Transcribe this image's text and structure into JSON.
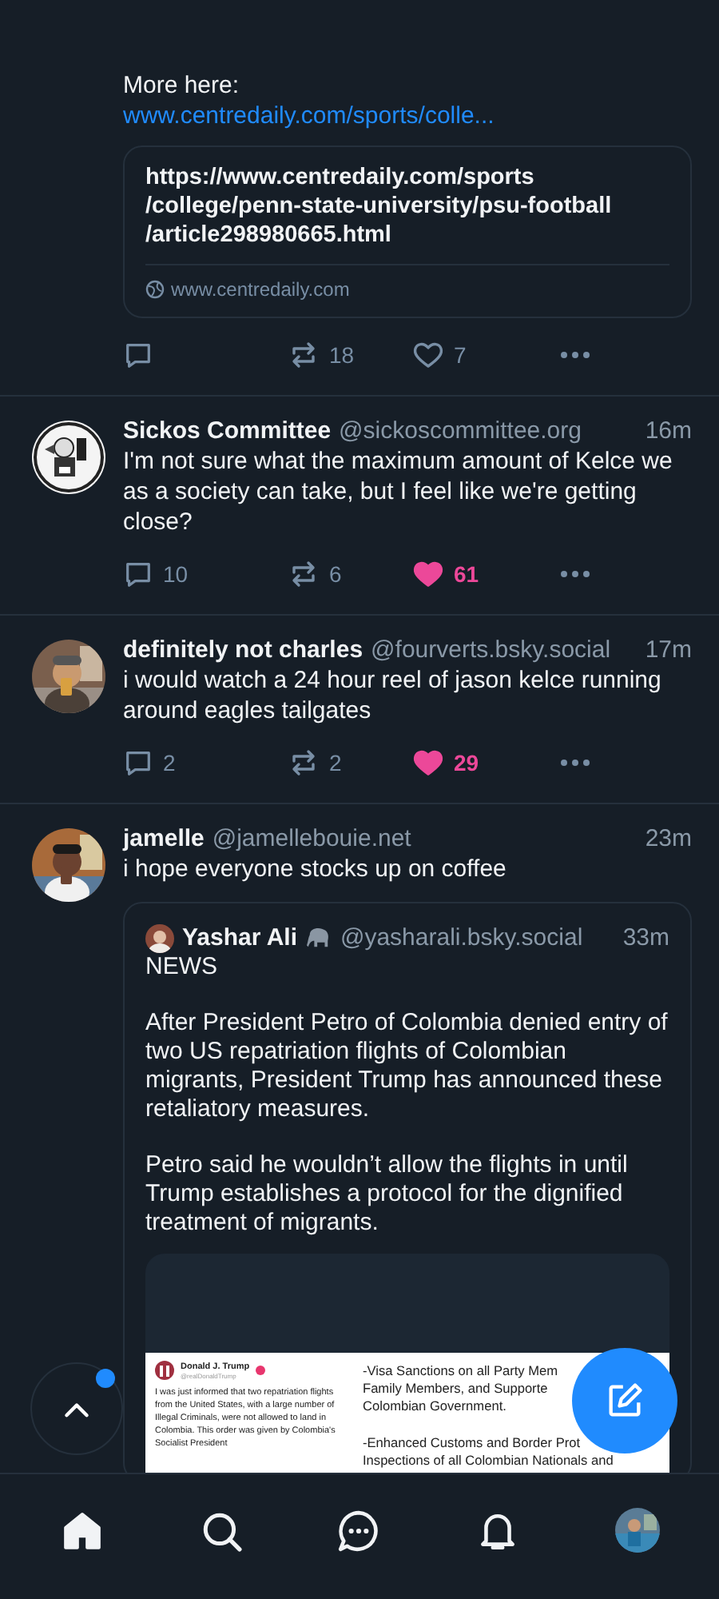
{
  "posts": [
    {
      "kind": "continuation",
      "paragraphs": [
        "More here:"
      ],
      "link": "www.centredaily.com/sports/colle...",
      "link_card": {
        "title_lines": [
          "https://www.centredaily.com/sports",
          "/college/penn-state-university/psu-football",
          "/article298980665.html"
        ],
        "domain": "www.centredaily.com"
      },
      "actions": {
        "reposts": "18",
        "likes": "7",
        "liked": false
      }
    },
    {
      "kind": "post",
      "name": "Sickos Committee",
      "handle": "@sickoscommittee.org",
      "time": "16m",
      "paragraphs": [
        "I'm not sure what the maximum amount of Kelce we as a society can take, but I feel like we're getting close?"
      ],
      "actions": {
        "replies": "10",
        "reposts": "6",
        "likes": "61",
        "liked": true
      }
    },
    {
      "kind": "post",
      "name": "definitely not charles",
      "handle": "@fourverts.bsky.social",
      "time": "17m",
      "paragraphs": [
        "i would watch a 24 hour reel of jason kelce running around eagles tailgates"
      ],
      "actions": {
        "replies": "2",
        "reposts": "2",
        "likes": "29",
        "liked": true
      }
    },
    {
      "kind": "post",
      "name": "jamelle",
      "handle": "@jamellebouie.net",
      "time": "23m",
      "paragraphs": [
        "i hope everyone stocks up on coffee"
      ],
      "quote": {
        "name": "Yashar Ali",
        "handle": "@yasharali.bsky.social",
        "time": "33m",
        "paragraphs": [
          "NEWS",
          "After President Petro of Colombia denied entry of two US repatriation flights of Colombian migrants, President Trump has announced these retaliatory measures.",
          "Petro said he wouldn’t allow the flights in until Trump establishes a protocol for the dignified treatment of migrants."
        ],
        "image": {
          "author": "Donald J. Trump",
          "handle": "@realDonaldTrump",
          "body": "I was just informed that two repatriation flights from the United States, with a large number of Illegal Criminals, were not allowed to land in Colombia. This order was given by Colombia's Socialist President",
          "right_paragraphs": [
            [
              "-Visa Sanctions on all Party Mem",
              "Family Members, and Supporte",
              "Colombian Government."
            ],
            [
              "-Enhanced Customs and Border Prot",
              "Inspections of all Colombian Nationals and"
            ]
          ]
        }
      }
    }
  ],
  "scroll_top": {
    "new_posts": true
  },
  "nav": [
    {
      "kind": "home",
      "selected": true
    },
    {
      "kind": "search",
      "selected": false
    },
    {
      "kind": "chat",
      "selected": false
    },
    {
      "kind": "bell",
      "selected": false
    },
    {
      "kind": "profile",
      "selected": false
    }
  ]
}
